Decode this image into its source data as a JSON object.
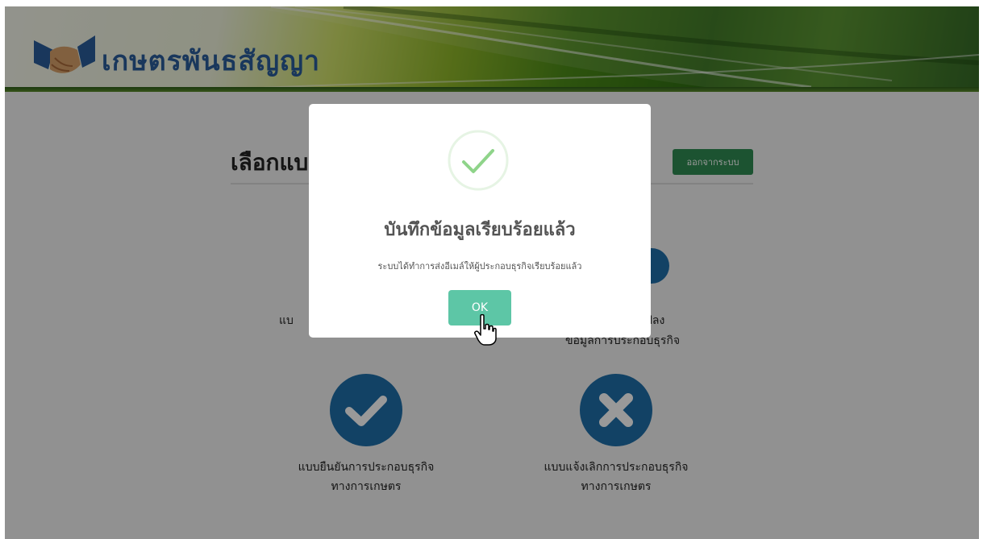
{
  "header": {
    "brand_name": "เกษตรพันธสัญญา",
    "logo_icon": "handshake-icon"
  },
  "page": {
    "title_visible": "เลือกแบ",
    "logout_label": "ออกจากระบบ",
    "options": [
      {
        "label_line1": "แบ",
        "label_line2": "",
        "icon": "document-icon"
      },
      {
        "label_line1": "ปลง",
        "label_line2": "ข้อมูลการประกอบธุรกิจ",
        "icon": "edit-icon"
      },
      {
        "label_line1": "แบบยืนยันการประกอบธุรกิจ",
        "label_line2": "ทางการเกษตร",
        "icon": "check-circle-icon"
      },
      {
        "label_line1": "แบบแจ้งเลิกการประกอบธุรกิจ",
        "label_line2": "ทางการเกษตร",
        "icon": "x-circle-icon"
      }
    ]
  },
  "modal": {
    "icon": "success-check-icon",
    "title": "บันทึกข้อมูลเรียบร้อยแล้ว",
    "message": "ระบบได้ทำการส่งอีเมล์ให้ผู้ประกอบธุรกิจเรียบร้อยแล้ว",
    "ok_label": "OK"
  },
  "colors": {
    "brand_blue": "#2b5d9a",
    "option_circle": "#1f6ea8",
    "logout_green": "#2f8a52",
    "ok_teal": "#5dc6a6",
    "success_green": "#8fd48a"
  }
}
